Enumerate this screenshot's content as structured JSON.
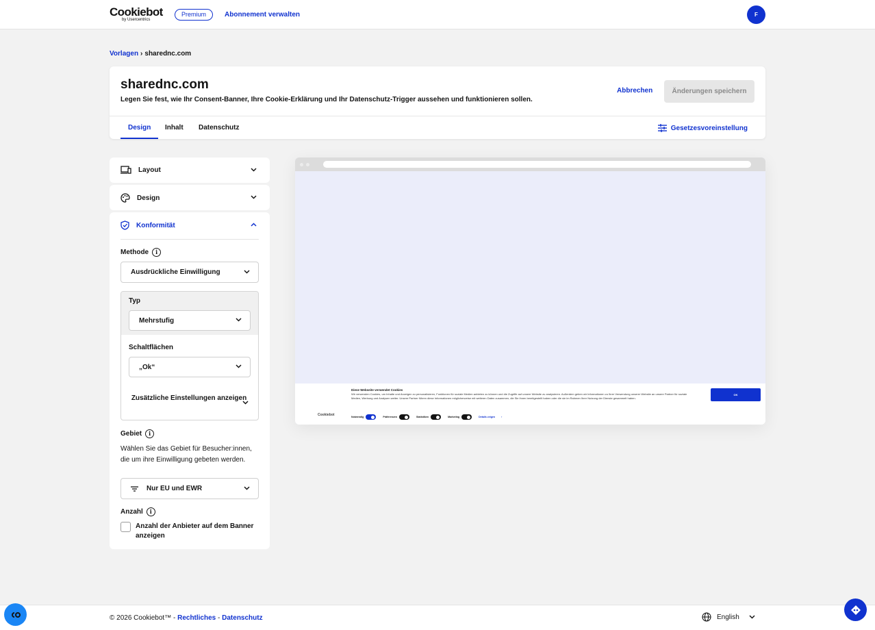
{
  "header": {
    "logo_main": "Cookiebot",
    "logo_sub": "by Usercentrics",
    "plan_badge": "Premium",
    "manage_link": "Abonnement verwalten",
    "avatar_initial": "F"
  },
  "breadcrumb": {
    "parent": "Vorlagen",
    "separator": "›",
    "current": "sharednc.com"
  },
  "page": {
    "title": "sharednc.com",
    "description": "Legen Sie fest, wie Ihr Consent-Banner, Ihre Cookie-Erklärung und Ihr Datenschutz-Trigger aussehen und funktionieren sollen.",
    "cancel_label": "Abbrechen",
    "save_label": "Änderungen speichern",
    "tabs": [
      {
        "label": "Design",
        "active": true
      },
      {
        "label": "Inhalt",
        "active": false
      },
      {
        "label": "Datenschutz",
        "active": false
      }
    ],
    "preset_label": "Gesetzesvoreinstellung"
  },
  "settings": {
    "sections": [
      {
        "label": "Layout",
        "icon": "devices-icon",
        "expanded": false
      },
      {
        "label": "Design",
        "icon": "palette-icon",
        "expanded": false
      },
      {
        "label": "Konformität",
        "icon": "shield-check-icon",
        "expanded": true
      }
    ],
    "method": {
      "label": "Methode",
      "value": "Ausdrückliche Einwilligung"
    },
    "type": {
      "label": "Typ",
      "value": "Mehrstufig"
    },
    "buttons": {
      "label": "Schaltflächen",
      "value": "„Ok“"
    },
    "more_settings": "Zusätzliche Einstellungen anzeigen",
    "region": {
      "label": "Gebiet",
      "description": "Wählen Sie das Gebiet für Besucher:innen, die um ihre Einwilligung gebeten werden.",
      "value": "Nur EU und EWR"
    },
    "count": {
      "label": "Anzahl",
      "checkbox_label": "Anzahl der Anbieter auf dem Banner anzeigen",
      "checked": false
    }
  },
  "preview": {
    "banner_logo": "Cookiebot",
    "banner_title": "Diese Webseite verwendet Cookies",
    "banner_text": "Wir verwenden Cookies, um Inhalte und Anzeigen zu personalisieren, Funktionen für soziale Medien anbieten zu können und die Zugriffe auf unsere Website zu analysieren. Außerdem geben wir Informationen zu Ihrer Verwendung unserer Website an unsere Partner für soziale Medien, Werbung und Analysen weiter. Unsere Partner führen diese Informationen möglicherweise mit weiteren Daten zusammen, die Sie ihnen bereitgestellt haben oder die sie im Rahmen Ihrer Nutzung der Dienste gesammelt haben.",
    "ok_label": "OK",
    "toggles": [
      {
        "label": "Notwendig",
        "on": true
      },
      {
        "label": "Präferenzen",
        "on": false
      },
      {
        "label": "Statistiken",
        "on": false
      },
      {
        "label": "Marketing",
        "on": false
      }
    ],
    "details_label": "Details zeigen",
    "details_arrow": "›"
  },
  "footer": {
    "copyright": "© 2026 Cookiebot™ -",
    "legal_link": "Rechtliches",
    "dash": "-",
    "privacy_link": "Datenschutz",
    "language": "English"
  },
  "colors": {
    "accent": "#1032cf",
    "background": "#f2f2f2",
    "preview_bg": "#ebedfa"
  }
}
